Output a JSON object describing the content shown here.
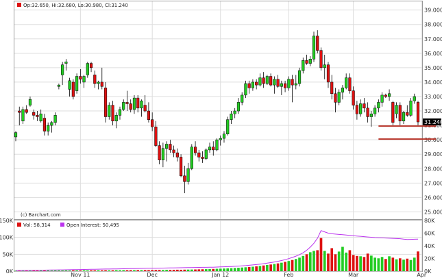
{
  "header": {
    "ohlc_text": "Op:32.650, Hi:32.680, Lo:30.980, Cl:31.240"
  },
  "watermark": "(c) Barchart.com",
  "volume_legend": {
    "vol_text": "Vol: 58,314",
    "oi_text": "Open Interest: 50,495"
  },
  "colors": {
    "up": "#22cc22",
    "down": "#dd1111",
    "open_interest": "#bb33ee",
    "support_line": "#b8352a",
    "last_label_bg": "#000000"
  },
  "chart_data": [
    {
      "type": "candlestick",
      "title": "",
      "x_tick_labels": [
        "Nov 11",
        "Dec",
        "Jan 12",
        "Feb",
        "Mar",
        "Apr"
      ],
      "x_tick_positions": [
        18,
        38,
        57,
        76,
        94,
        113
      ],
      "y_ticks": [
        25,
        26,
        27,
        28,
        29,
        30,
        31,
        32,
        33,
        34,
        35,
        36,
        37,
        38,
        39
      ],
      "y_tick_labels": [
        "25.000",
        "26.000",
        "27.000",
        "28.000",
        "29.000",
        "30.000",
        "31.000",
        "32.000",
        "33.000",
        "34.000",
        "35.000",
        "36.000",
        "37.000",
        "38.000",
        "39.000"
      ],
      "ylim": [
        24.5,
        39.6
      ],
      "last_value_label": "31.240",
      "last_value": 31.24,
      "support_levels": [
        {
          "value": 30.95,
          "from_index": 101,
          "to_index": 117
        },
        {
          "value": 30.05,
          "from_index": 101,
          "to_index": 117
        }
      ],
      "candles": [
        [
          30.2,
          30.6,
          29.9,
          30.5
        ],
        [
          32.0,
          32.3,
          31.0,
          31.9
        ],
        [
          31.3,
          32.3,
          31.1,
          32.1
        ],
        [
          32.1,
          32.4,
          31.8,
          31.9
        ],
        [
          32.4,
          33.0,
          32.3,
          32.8
        ],
        [
          31.9,
          32.1,
          31.4,
          31.7
        ],
        [
          31.7,
          32.0,
          31.3,
          31.6
        ],
        [
          31.3,
          32.1,
          31.2,
          31.8
        ],
        [
          31.5,
          31.8,
          30.3,
          30.6
        ],
        [
          30.6,
          31.2,
          30.3,
          31.0
        ],
        [
          31.0,
          31.3,
          30.5,
          31.2
        ],
        [
          31.2,
          31.9,
          31.0,
          31.7
        ],
        [
          33.7,
          33.9,
          33.5,
          33.8
        ],
        [
          34.5,
          35.4,
          33.8,
          35.2
        ],
        [
          35.3,
          35.6,
          34.8,
          35.4
        ],
        [
          33.5,
          34.3,
          33.0,
          34.1
        ],
        [
          34.0,
          34.2,
          32.8,
          33.0
        ],
        [
          33.4,
          34.6,
          33.2,
          34.4
        ],
        [
          34.4,
          34.9,
          33.9,
          34.2
        ],
        [
          34.0,
          34.5,
          33.6,
          34.4
        ],
        [
          34.5,
          35.4,
          34.3,
          35.3
        ],
        [
          35.3,
          35.4,
          34.7,
          35.0
        ],
        [
          34.5,
          34.8,
          33.6,
          33.9
        ],
        [
          33.9,
          34.1,
          33.5,
          34.0
        ],
        [
          34.0,
          35.0,
          33.5,
          33.7
        ],
        [
          33.6,
          34.0,
          31.2,
          31.6
        ],
        [
          31.6,
          32.6,
          31.4,
          32.4
        ],
        [
          32.4,
          32.7,
          31.0,
          31.3
        ],
        [
          31.3,
          31.9,
          30.8,
          31.7
        ],
        [
          31.7,
          32.3,
          31.4,
          32.1
        ],
        [
          32.1,
          32.8,
          32.0,
          32.6
        ],
        [
          32.6,
          33.4,
          32.0,
          32.5
        ],
        [
          32.5,
          32.8,
          31.9,
          32.1
        ],
        [
          32.1,
          33.1,
          31.8,
          32.9
        ],
        [
          32.9,
          33.1,
          31.9,
          32.2
        ],
        [
          32.2,
          32.8,
          31.6,
          32.7
        ],
        [
          32.4,
          33.1,
          31.9,
          32.0
        ],
        [
          32.0,
          32.6,
          31.2,
          31.4
        ],
        [
          31.4,
          31.9,
          30.6,
          30.9
        ],
        [
          30.9,
          31.3,
          29.5,
          29.6
        ],
        [
          29.6,
          29.9,
          28.3,
          28.6
        ],
        [
          28.6,
          29.8,
          28.1,
          29.4
        ],
        [
          29.4,
          29.9,
          28.5,
          29.7
        ],
        [
          29.7,
          30.0,
          29.1,
          29.3
        ],
        [
          29.3,
          29.6,
          28.8,
          29.1
        ],
        [
          29.1,
          29.4,
          28.5,
          28.8
        ],
        [
          28.8,
          29.0,
          27.4,
          27.5
        ],
        [
          27.5,
          28.2,
          26.3,
          27.1
        ],
        [
          27.1,
          28.4,
          26.9,
          28.0
        ],
        [
          28.0,
          29.7,
          27.9,
          29.5
        ],
        [
          29.5,
          29.9,
          28.9,
          29.1
        ],
        [
          29.1,
          29.3,
          28.5,
          28.8
        ],
        [
          28.8,
          29.2,
          28.4,
          28.7
        ],
        [
          28.7,
          29.4,
          28.6,
          29.3
        ],
        [
          29.3,
          29.8,
          29.1,
          29.5
        ],
        [
          29.5,
          29.9,
          28.9,
          29.3
        ],
        [
          29.3,
          30.1,
          29.2,
          30.0
        ],
        [
          30.0,
          30.3,
          29.6,
          30.1
        ],
        [
          30.1,
          30.6,
          29.8,
          30.4
        ],
        [
          30.4,
          31.6,
          30.3,
          31.4
        ],
        [
          31.4,
          32.0,
          31.1,
          31.8
        ],
        [
          31.8,
          32.2,
          31.5,
          32.0
        ],
        [
          32.0,
          32.9,
          31.8,
          32.6
        ],
        [
          32.6,
          33.3,
          32.4,
          33.1
        ],
        [
          33.1,
          34.1,
          32.9,
          33.9
        ],
        [
          33.9,
          34.1,
          33.2,
          33.6
        ],
        [
          33.6,
          34.2,
          33.4,
          34.0
        ],
        [
          34.0,
          34.2,
          33.5,
          33.8
        ],
        [
          33.8,
          34.6,
          33.7,
          34.3
        ],
        [
          34.3,
          34.7,
          33.6,
          33.9
        ],
        [
          33.9,
          34.5,
          33.8,
          34.4
        ],
        [
          34.4,
          34.6,
          33.7,
          33.8
        ],
        [
          33.8,
          34.4,
          33.2,
          34.2
        ],
        [
          34.2,
          34.5,
          33.6,
          33.7
        ],
        [
          33.7,
          34.1,
          33.1,
          33.9
        ],
        [
          33.9,
          34.1,
          33.3,
          33.6
        ],
        [
          33.6,
          34.4,
          33.4,
          34.2
        ],
        [
          34.2,
          34.5,
          32.6,
          33.8
        ],
        [
          33.8,
          34.5,
          33.5,
          33.9
        ],
        [
          33.9,
          35.0,
          33.7,
          34.8
        ],
        [
          34.8,
          35.7,
          34.6,
          35.5
        ],
        [
          35.5,
          35.9,
          35.2,
          35.3
        ],
        [
          35.3,
          35.8,
          35.1,
          35.6
        ],
        [
          35.6,
          37.5,
          35.4,
          37.2
        ],
        [
          37.2,
          37.6,
          36.0,
          36.2
        ],
        [
          36.2,
          36.4,
          34.8,
          35.0
        ],
        [
          35.0,
          35.9,
          34.2,
          35.2
        ],
        [
          35.2,
          35.4,
          33.6,
          34.0
        ],
        [
          34.0,
          34.5,
          32.8,
          33.2
        ],
        [
          33.2,
          33.6,
          31.9,
          32.6
        ],
        [
          32.6,
          33.5,
          32.4,
          33.3
        ],
        [
          33.3,
          33.8,
          32.8,
          33.6
        ],
        [
          33.6,
          34.6,
          33.5,
          34.3
        ],
        [
          34.3,
          34.6,
          33.2,
          33.4
        ],
        [
          33.4,
          33.7,
          32.1,
          32.4
        ],
        [
          32.4,
          32.7,
          31.4,
          31.8
        ],
        [
          31.8,
          32.8,
          31.6,
          32.5
        ],
        [
          32.5,
          32.9,
          31.9,
          32.2
        ],
        [
          32.2,
          32.6,
          31.2,
          31.6
        ],
        [
          31.6,
          32.0,
          30.9,
          31.8
        ],
        [
          31.8,
          32.4,
          31.6,
          32.2
        ],
        [
          32.2,
          32.8,
          31.9,
          32.6
        ],
        [
          32.6,
          33.3,
          32.3,
          33.1
        ],
        [
          33.1,
          33.2,
          32.9,
          33.0
        ],
        [
          33.0,
          33.5,
          32.7,
          33.2
        ],
        [
          32.6,
          32.7,
          31.0,
          31.2
        ],
        [
          31.8,
          32.6,
          31.5,
          32.4
        ],
        [
          32.4,
          32.6,
          31.0,
          31.3
        ],
        [
          31.3,
          32.0,
          31.1,
          31.9
        ],
        [
          31.9,
          32.4,
          31.6,
          31.7
        ],
        [
          31.7,
          32.9,
          31.6,
          32.7
        ],
        [
          32.7,
          33.2,
          32.5,
          33.0
        ],
        [
          32.6,
          32.7,
          31.0,
          31.24
        ]
      ]
    },
    {
      "type": "bar+line",
      "title": "",
      "y_left_tick_labels": [
        "0K",
        "50K",
        "100K",
        "150K"
      ],
      "y_left_ticks": [
        0,
        50000,
        100000,
        150000
      ],
      "y_right_tick_labels": [
        "0K",
        "20K",
        "40K",
        "60K",
        "80K"
      ],
      "y_right_ticks": [
        0,
        20000,
        40000,
        60000,
        80000
      ],
      "ylim_left": [
        0,
        150000
      ],
      "ylim_right": [
        0,
        80000
      ],
      "series": [
        {
          "name": "Vol: 58,314",
          "type": "bar",
          "values": [
            1500,
            1400,
            1600,
            1500,
            1700,
            1800,
            1600,
            1900,
            1700,
            2000,
            1800,
            2100,
            2200,
            2000,
            2300,
            2100,
            2400,
            2300,
            2200,
            2500,
            2300,
            2600,
            2400,
            2700,
            2500,
            2800,
            2600,
            2700,
            2900,
            2800,
            3000,
            2900,
            3100,
            3000,
            3200,
            3100,
            3300,
            3200,
            3400,
            3500,
            3600,
            3500,
            3800,
            3700,
            4000,
            4200,
            4100,
            4400,
            4600,
            4800,
            5000,
            5300,
            5600,
            5900,
            6200,
            6600,
            7000,
            7400,
            7800,
            8300,
            8800,
            9400,
            10000,
            10700,
            11500,
            12300,
            13200,
            14200,
            15400,
            16800,
            18200,
            19700,
            21300,
            23000,
            25000,
            27500,
            30000,
            33000,
            36000,
            40000,
            45000,
            50000,
            56000,
            60000,
            62000,
            98000,
            60000,
            52000,
            68000,
            50000,
            58000,
            72000,
            55000,
            62000,
            48000,
            45000,
            44000,
            42000,
            52000,
            46000,
            40000,
            38000,
            42000,
            36000,
            44000,
            40000,
            35000,
            38000,
            34000,
            37000,
            33000,
            40000,
            58314
          ]
        },
        {
          "name": "Open Interest: 50,495",
          "type": "line",
          "values": [
            1000,
            1100,
            1200,
            1200,
            1300,
            1400,
            1500,
            1500,
            1600,
            1700,
            1800,
            1900,
            2000,
            2100,
            2200,
            2300,
            2400,
            2500,
            2600,
            2700,
            2800,
            2900,
            3000,
            3100,
            3200,
            3300,
            3400,
            3500,
            3600,
            3700,
            3800,
            3900,
            4000,
            4100,
            4200,
            4300,
            4400,
            4500,
            4600,
            4700,
            4800,
            4900,
            5000,
            5100,
            5200,
            5300,
            5400,
            5500,
            5600,
            5700,
            5800,
            5900,
            6000,
            6100,
            6200,
            6300,
            6500,
            6700,
            6900,
            7100,
            7400,
            7700,
            8000,
            8400,
            8800,
            9300,
            9800,
            10400,
            11000,
            11800,
            12600,
            13500,
            14500,
            15600,
            16800,
            18200,
            19800,
            21600,
            23700,
            26000,
            29000,
            33000,
            38000,
            44000,
            52000,
            64000,
            62000,
            60000,
            59000,
            58500,
            58000,
            57500,
            57000,
            56500,
            56000,
            55500,
            55000,
            54500,
            54000,
            53500,
            53000,
            52800,
            52500,
            52300,
            52000,
            51800,
            51500,
            51200,
            50500,
            50000,
            50200,
            50400,
            50495
          ]
        }
      ]
    }
  ]
}
